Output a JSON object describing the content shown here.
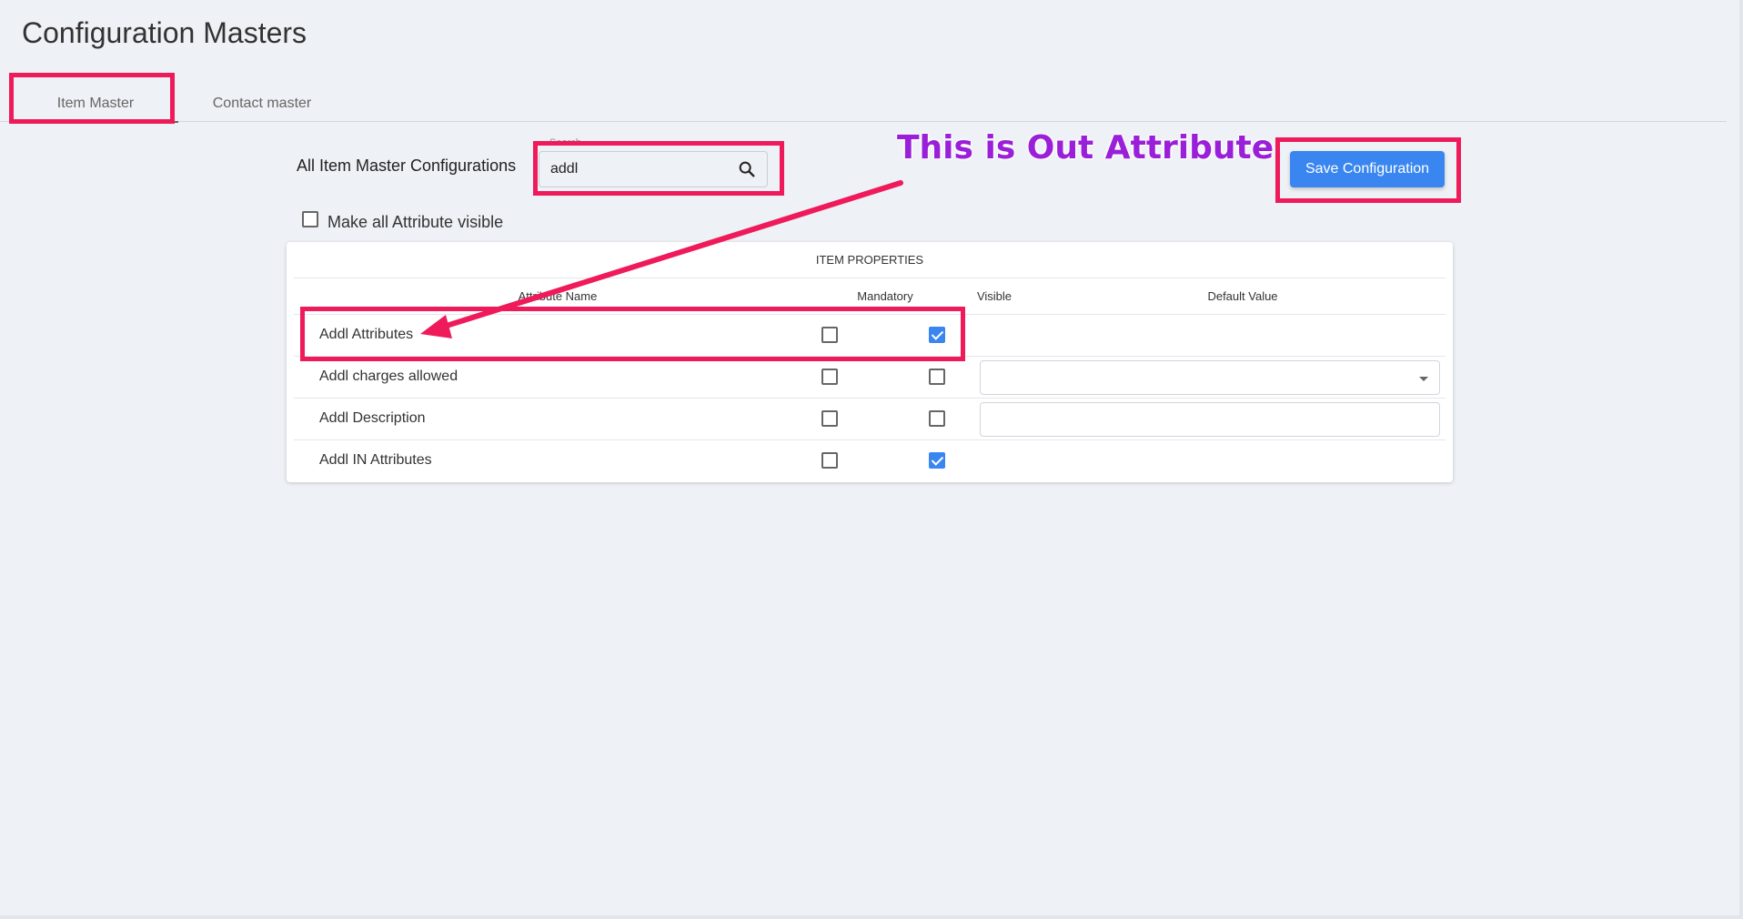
{
  "page": {
    "title": "Configuration Masters"
  },
  "tabs": [
    {
      "label": "Item Master",
      "active": true
    },
    {
      "label": "Contact master",
      "active": false
    }
  ],
  "section": {
    "title": "All Item Master Configurations"
  },
  "search": {
    "label": "Search",
    "value": "addl",
    "icon": "search-icon"
  },
  "save_button": {
    "label": "Save Configuration"
  },
  "make_all_visible": {
    "label": "Make all Attribute visible",
    "checked": false
  },
  "table": {
    "title": "ITEM PROPERTIES",
    "headers": {
      "name": "Attribute Name",
      "mandatory": "Mandatory",
      "visible": "Visible",
      "default": "Default Value"
    },
    "rows": [
      {
        "name": "Addl Attributes",
        "mandatory": false,
        "visible": true,
        "default_type": "none"
      },
      {
        "name": "Addl charges allowed",
        "mandatory": false,
        "visible": false,
        "default_type": "select"
      },
      {
        "name": "Addl Description",
        "mandatory": false,
        "visible": false,
        "default_type": "text"
      },
      {
        "name": "Addl IN Attributes",
        "mandatory": false,
        "visible": true,
        "default_type": "none"
      }
    ]
  },
  "annotation": {
    "text": "This is Out Attribute",
    "highlight_color": "#ef1a5a",
    "text_color": "#9a1fd8"
  },
  "colors": {
    "accent": "#3a86f0",
    "background": "#eef1f5"
  }
}
